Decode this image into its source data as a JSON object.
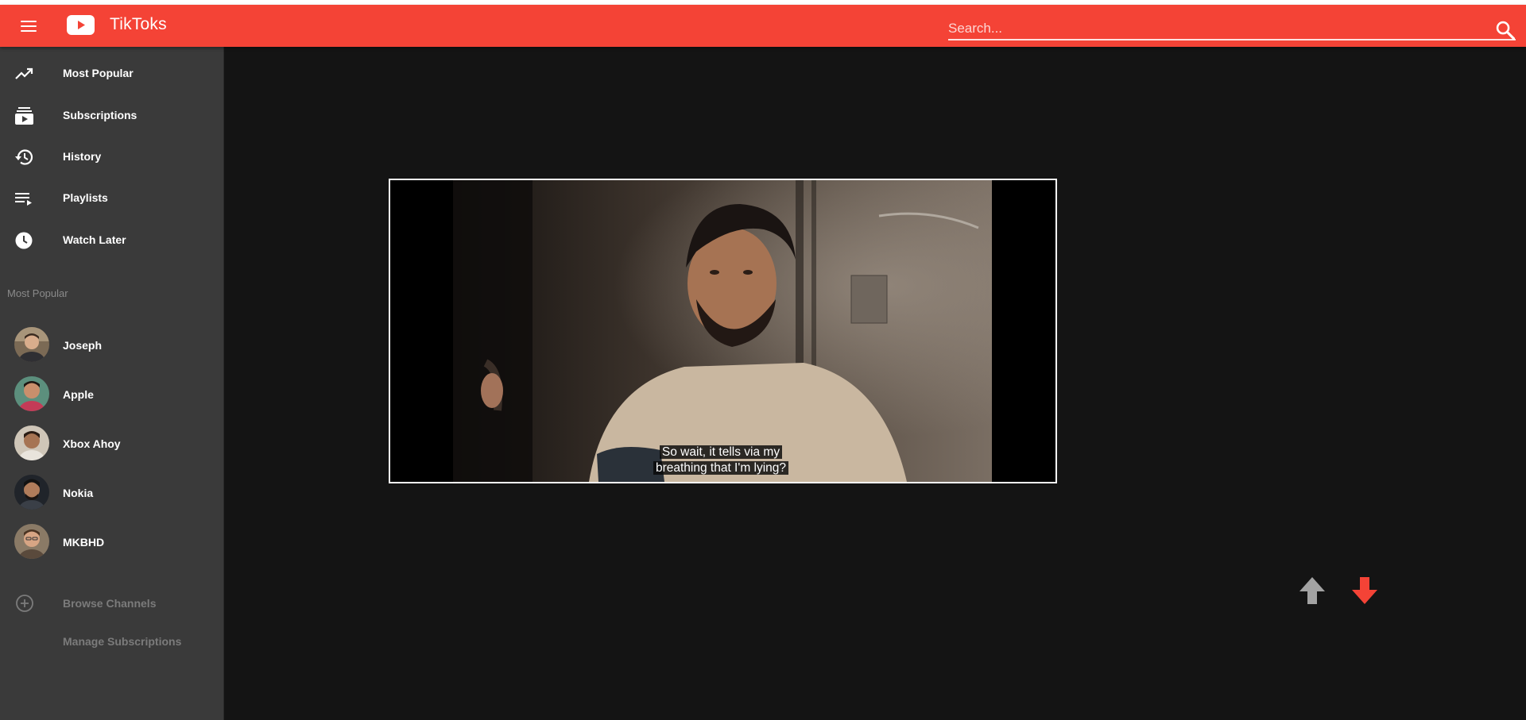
{
  "app": {
    "title": "TikToks",
    "brand_color": "#f44336"
  },
  "icons": {
    "menu": "menu-icon",
    "logo": "play-logo-icon",
    "search": "search-icon",
    "most_popular": "trending-up-icon",
    "subscriptions": "subscriptions-icon",
    "history": "history-icon",
    "playlists": "playlist-icon",
    "watch_later": "clock-icon",
    "browse": "add-circle-icon",
    "up_arrow": "arrow-up-icon",
    "down_arrow": "arrow-down-icon"
  },
  "search": {
    "placeholder": "Search...",
    "value": ""
  },
  "sidebar": {
    "nav_items": [
      {
        "label": "Most Popular"
      },
      {
        "label": "Subscriptions"
      },
      {
        "label": "History"
      },
      {
        "label": "Playlists"
      },
      {
        "label": "Watch Later"
      }
    ],
    "section_title": "Most Popular",
    "channels": [
      {
        "label": "Joseph"
      },
      {
        "label": "Apple"
      },
      {
        "label": "Xbox Ahoy"
      },
      {
        "label": "Nokia"
      },
      {
        "label": "MKBHD"
      }
    ],
    "browse_label": "Browse Channels",
    "manage_label": "Manage Subscriptions"
  },
  "video": {
    "caption_line1": "So wait, it tells via my",
    "caption_line2": "breathing that I'm lying?"
  },
  "controls": {
    "up_color": "#a3a3a3",
    "down_color": "#f44336"
  }
}
